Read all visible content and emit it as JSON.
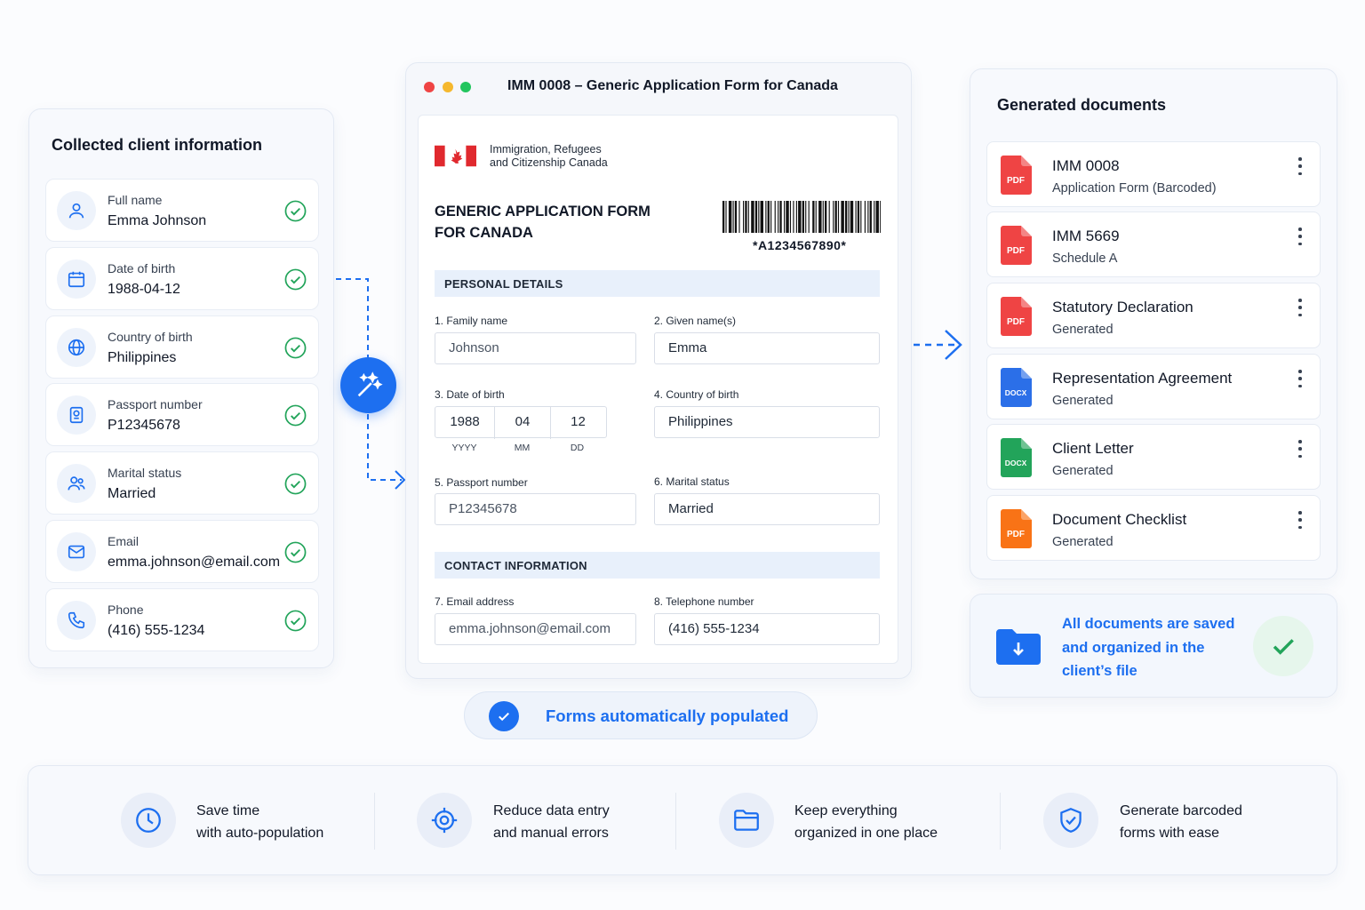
{
  "collected": {
    "title": "Collected client information",
    "items": [
      {
        "label": "Full name",
        "value": "Emma Johnson",
        "icon": "user-icon"
      },
      {
        "label": "Date of birth",
        "value": "1988-04-12",
        "icon": "calendar-icon"
      },
      {
        "label": "Country of birth",
        "value": "Philippines",
        "icon": "globe-icon"
      },
      {
        "label": "Passport number",
        "value": "P12345678",
        "icon": "passport-icon"
      },
      {
        "label": "Marital status",
        "value": "Married",
        "icon": "users-icon"
      },
      {
        "label": "Email",
        "value": "emma.johnson@email.com",
        "icon": "mail-icon"
      },
      {
        "label": "Phone",
        "value": "(416) 555-1234",
        "icon": "phone-icon"
      }
    ]
  },
  "form": {
    "window_title": "IMM 0008 – Generic Application Form for Canada",
    "agency_line1": "Immigration, Refugees",
    "agency_line2": "and Citizenship Canada",
    "title_line1": "GENERIC APPLICATION FORM",
    "title_line2": "FOR CANADA",
    "barcode_text": "*A1234567890*",
    "section_personal": "PERSONAL DETAILS",
    "section_contact": "CONTACT INFORMATION",
    "family_name_label": "1. Family name",
    "family_name": "Johnson",
    "given_name_label": "2. Given name(s)",
    "given_name": "Emma",
    "dob_label": "3. Date of birth",
    "dob_year": "1988",
    "dob_month": "04",
    "dob_day": "12",
    "dob_year_hint": "YYYY",
    "dob_month_hint": "MM",
    "dob_day_hint": "DD",
    "country_label": "4. Country of birth",
    "country": "Philippines",
    "passport_label": "5. Passport number",
    "passport": "P12345678",
    "marital_label": "6. Marital status",
    "marital": "Married",
    "email_label": "7. Email address",
    "email": "emma.johnson@email.com",
    "phone_label": "8. Telephone number",
    "phone": "(416) 555-1234"
  },
  "auto_populated_label": "Forms automatically populated",
  "documents": {
    "title": "Generated documents",
    "items": [
      {
        "name": "IMM 0008",
        "sub": "Application Form (Barcoded)",
        "type": "PDF",
        "color": "#ef4444"
      },
      {
        "name": "IMM 5669",
        "sub": "Schedule A",
        "type": "PDF",
        "color": "#ef4444"
      },
      {
        "name": "Statutory Declaration",
        "sub": "Generated",
        "type": "PDF",
        "color": "#ef4444"
      },
      {
        "name": "Representation Agreement",
        "sub": "Generated",
        "type": "DOCX",
        "color": "#2b6fe8"
      },
      {
        "name": "Client Letter",
        "sub": "Generated",
        "type": "DOCX",
        "color": "#22a45a"
      },
      {
        "name": "Document Checklist",
        "sub": "Generated",
        "type": "PDF",
        "color": "#f97316"
      }
    ]
  },
  "saved_notice": "All documents are saved and organized in the client’s file",
  "benefits": [
    {
      "line1": "Save time",
      "line2": "with auto-population",
      "icon": "clock-icon"
    },
    {
      "line1": "Reduce data entry",
      "line2": "and manual errors",
      "icon": "target-icon"
    },
    {
      "line1": "Keep everything",
      "line2": "organized in one place",
      "icon": "folder-icon"
    },
    {
      "line1": "Generate barcoded",
      "line2": "forms with ease",
      "icon": "shield-check-icon"
    }
  ],
  "colors": {
    "accent": "#1d6ff0",
    "success": "#22a45a",
    "pdf": "#ef4444",
    "docx": "#2b6fe8"
  }
}
